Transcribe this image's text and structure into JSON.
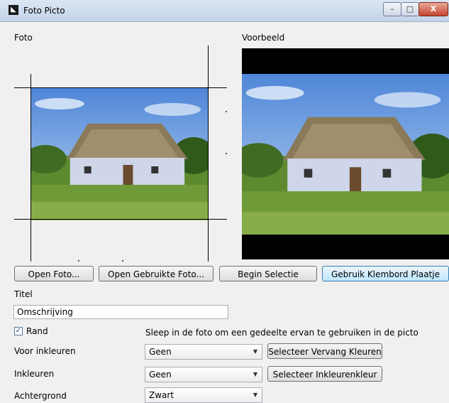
{
  "window": {
    "title": "Foto Picto",
    "icon": "app-logo-icon"
  },
  "labels": {
    "foto": "Foto",
    "voorbeeld": "Voorbeeld",
    "titel": "Titel",
    "hint": "Sleep in de foto om een gedeelte ervan te gebruiken in de picto",
    "voor_inkleuren": "Voor inkleuren",
    "inkleuren": "Inkleuren",
    "achtergrond": "Achtergrond"
  },
  "buttons": {
    "open_foto": "Open Foto...",
    "open_gebruikte": "Open Gebruikte Foto...",
    "begin_selectie": "Begin Selectie",
    "klembord": "Gebruik Klembord Plaatje",
    "vervang_kleuren": "Selecteer Vervang Kleuren",
    "inkleurenkleur": "Selecteer Inkleurenkleur"
  },
  "fields": {
    "titel_value": "Omschrijving"
  },
  "checkbox": {
    "label": "Rand",
    "checked": "✓"
  },
  "selects": {
    "voor_inkleuren": "Geen",
    "inkleuren": "Geen",
    "achtergrond": "Zwart"
  },
  "window_controls": {
    "minimize": "–",
    "maximize": "□",
    "close": "X"
  }
}
